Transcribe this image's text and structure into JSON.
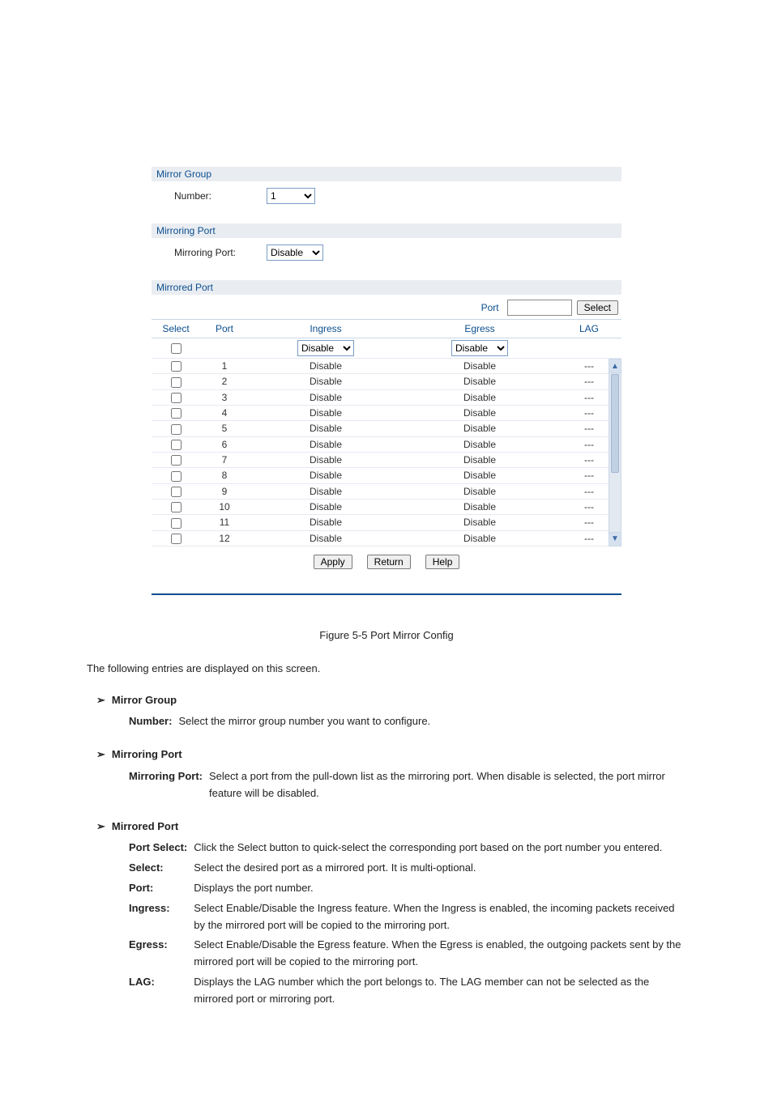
{
  "panel": {
    "mirror_group": {
      "heading": "Mirror Group",
      "number_label": "Number:",
      "number_value": "1"
    },
    "mirroring_port": {
      "heading": "Mirroring Port",
      "label": "Mirroring Port:",
      "value": "Disable"
    },
    "mirrored_port": {
      "heading": "Mirrored Port",
      "search_label": "Port",
      "search_value": "",
      "select_button": "Select",
      "columns": {
        "select": "Select",
        "port": "Port",
        "ingress": "Ingress",
        "egress": "Egress",
        "lag": "LAG"
      },
      "header_defaults": {
        "ingress": "Disable",
        "egress": "Disable"
      },
      "rows": [
        {
          "port": "1",
          "ingress": "Disable",
          "egress": "Disable",
          "lag": "---"
        },
        {
          "port": "2",
          "ingress": "Disable",
          "egress": "Disable",
          "lag": "---"
        },
        {
          "port": "3",
          "ingress": "Disable",
          "egress": "Disable",
          "lag": "---"
        },
        {
          "port": "4",
          "ingress": "Disable",
          "egress": "Disable",
          "lag": "---"
        },
        {
          "port": "5",
          "ingress": "Disable",
          "egress": "Disable",
          "lag": "---"
        },
        {
          "port": "6",
          "ingress": "Disable",
          "egress": "Disable",
          "lag": "---"
        },
        {
          "port": "7",
          "ingress": "Disable",
          "egress": "Disable",
          "lag": "---"
        },
        {
          "port": "8",
          "ingress": "Disable",
          "egress": "Disable",
          "lag": "---"
        },
        {
          "port": "9",
          "ingress": "Disable",
          "egress": "Disable",
          "lag": "---"
        },
        {
          "port": "10",
          "ingress": "Disable",
          "egress": "Disable",
          "lag": "---"
        },
        {
          "port": "11",
          "ingress": "Disable",
          "egress": "Disable",
          "lag": "---"
        },
        {
          "port": "12",
          "ingress": "Disable",
          "egress": "Disable",
          "lag": "---"
        }
      ],
      "buttons": {
        "apply": "Apply",
        "return": "Return",
        "help": "Help"
      }
    }
  },
  "doc": {
    "caption": "Figure 5-5 Port Mirror Config",
    "lead": "The following entries are displayed on this screen.",
    "sections": [
      {
        "title": "Mirror Group",
        "items": [
          {
            "k": "Number:",
            "v": "Select the mirror group number you want to configure."
          }
        ]
      },
      {
        "title": "Mirroring Port",
        "items": [
          {
            "k": "Mirroring Port:",
            "v": "Select a port from the pull-down list as the mirroring port. When disable is selected, the port mirror feature will be disabled."
          }
        ]
      },
      {
        "title": "Mirrored Port",
        "items": [
          {
            "k": "Port Select:",
            "v": "Click the Select button to quick-select the corresponding port based on the port number you entered."
          },
          {
            "k": "Select:",
            "v": "Select the desired port as a mirrored port. It is multi-optional."
          },
          {
            "k": "Port:",
            "v": "Displays the port number."
          },
          {
            "k": "Ingress:",
            "v": "Select Enable/Disable the Ingress feature. When the Ingress is enabled, the incoming packets received by the mirrored port will be copied to the mirroring port."
          },
          {
            "k": "Egress:",
            "v": "Select Enable/Disable the Egress feature. When the Egress is enabled, the outgoing packets sent by the mirrored port will be copied to the mirroring port."
          },
          {
            "k": "LAG:",
            "v": "Displays the LAG number which the port belongs to. The LAG member can not be selected as the mirrored port or mirroring port."
          }
        ]
      }
    ]
  }
}
